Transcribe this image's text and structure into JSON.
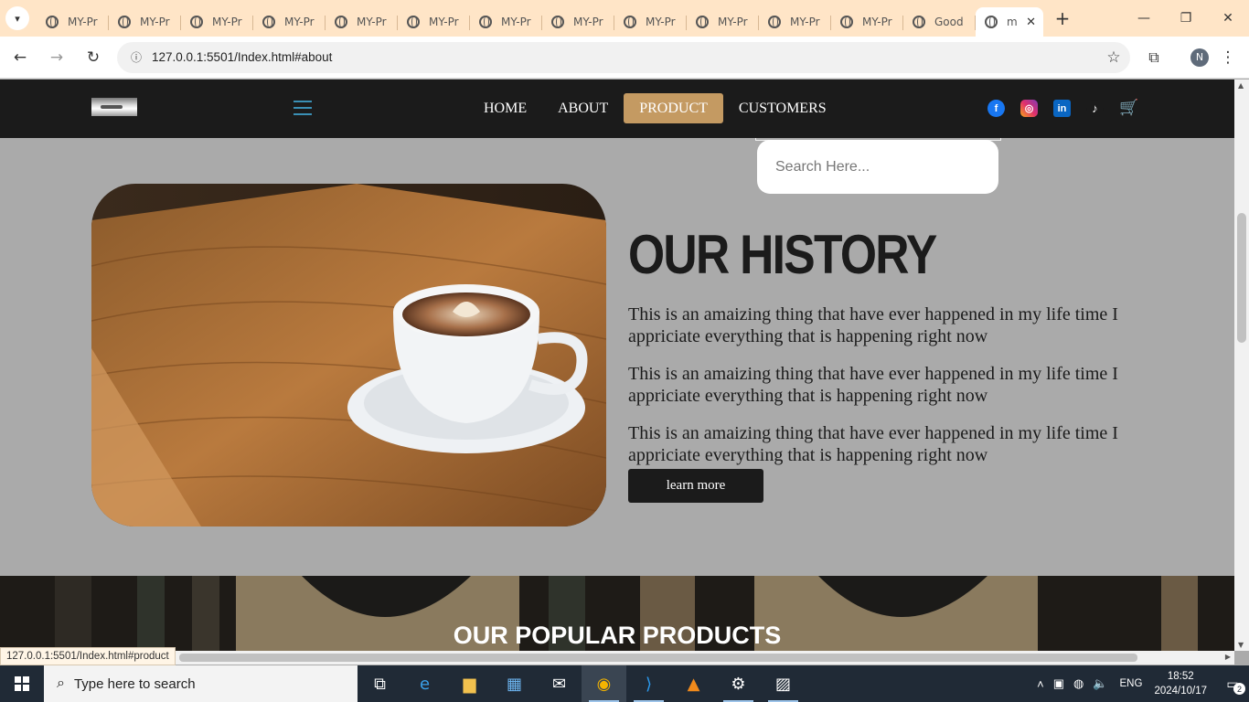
{
  "browser": {
    "tabs": [
      {
        "title": "MY-Pr",
        "active": false
      },
      {
        "title": "MY-Pr",
        "active": false
      },
      {
        "title": "MY-Pr",
        "active": false
      },
      {
        "title": "MY-Pr",
        "active": false
      },
      {
        "title": "MY-Pr",
        "active": false
      },
      {
        "title": "MY-Pr",
        "active": false
      },
      {
        "title": "MY-Pr",
        "active": false
      },
      {
        "title": "MY-Pr",
        "active": false
      },
      {
        "title": "MY-Pr",
        "active": false
      },
      {
        "title": "MY-Pr",
        "active": false
      },
      {
        "title": "MY-Pr",
        "active": false
      },
      {
        "title": "MY-Pr",
        "active": false
      },
      {
        "title": "Good",
        "active": false
      },
      {
        "title": "m",
        "active": true
      }
    ],
    "url": "127.0.0.1:5501/Index.html#about",
    "profile_initial": "N",
    "status_url": "127.0.0.1:5501/Index.html#product",
    "tabstrip_color": "#ffe5c7"
  },
  "site": {
    "nav": {
      "home": "HOME",
      "about": "ABOUT",
      "product": "PRODUCT",
      "customers": "CUSTOMERS"
    },
    "search_placeholder": "Search Here...",
    "history": {
      "title": "OUR HISTORY",
      "paragraphs": [
        "This is an amaizing thing that have ever happened in my life time I appriciate everything that is happening right now",
        "This is an amaizing thing that have ever happened in my life time I appriciate everything that is happening right now",
        "This is an amaizing thing that have ever happened in my life time I appriciate everything that is happening right now"
      ],
      "button": "learn more"
    },
    "products_title": "OUR POPULAR PRODUCTS",
    "socials": [
      "facebook-icon",
      "instagram-icon",
      "linkedin-icon",
      "tiktok-icon",
      "cart-icon"
    ],
    "colors": {
      "header_bg": "#1b1b1b",
      "accent": "#c49a62",
      "page_bg": "#aaaaaa"
    }
  },
  "taskbar": {
    "search_placeholder": "Type here to search",
    "language": "ENG",
    "time": "18:52",
    "date": "2024/10/17",
    "notifications": "2"
  }
}
